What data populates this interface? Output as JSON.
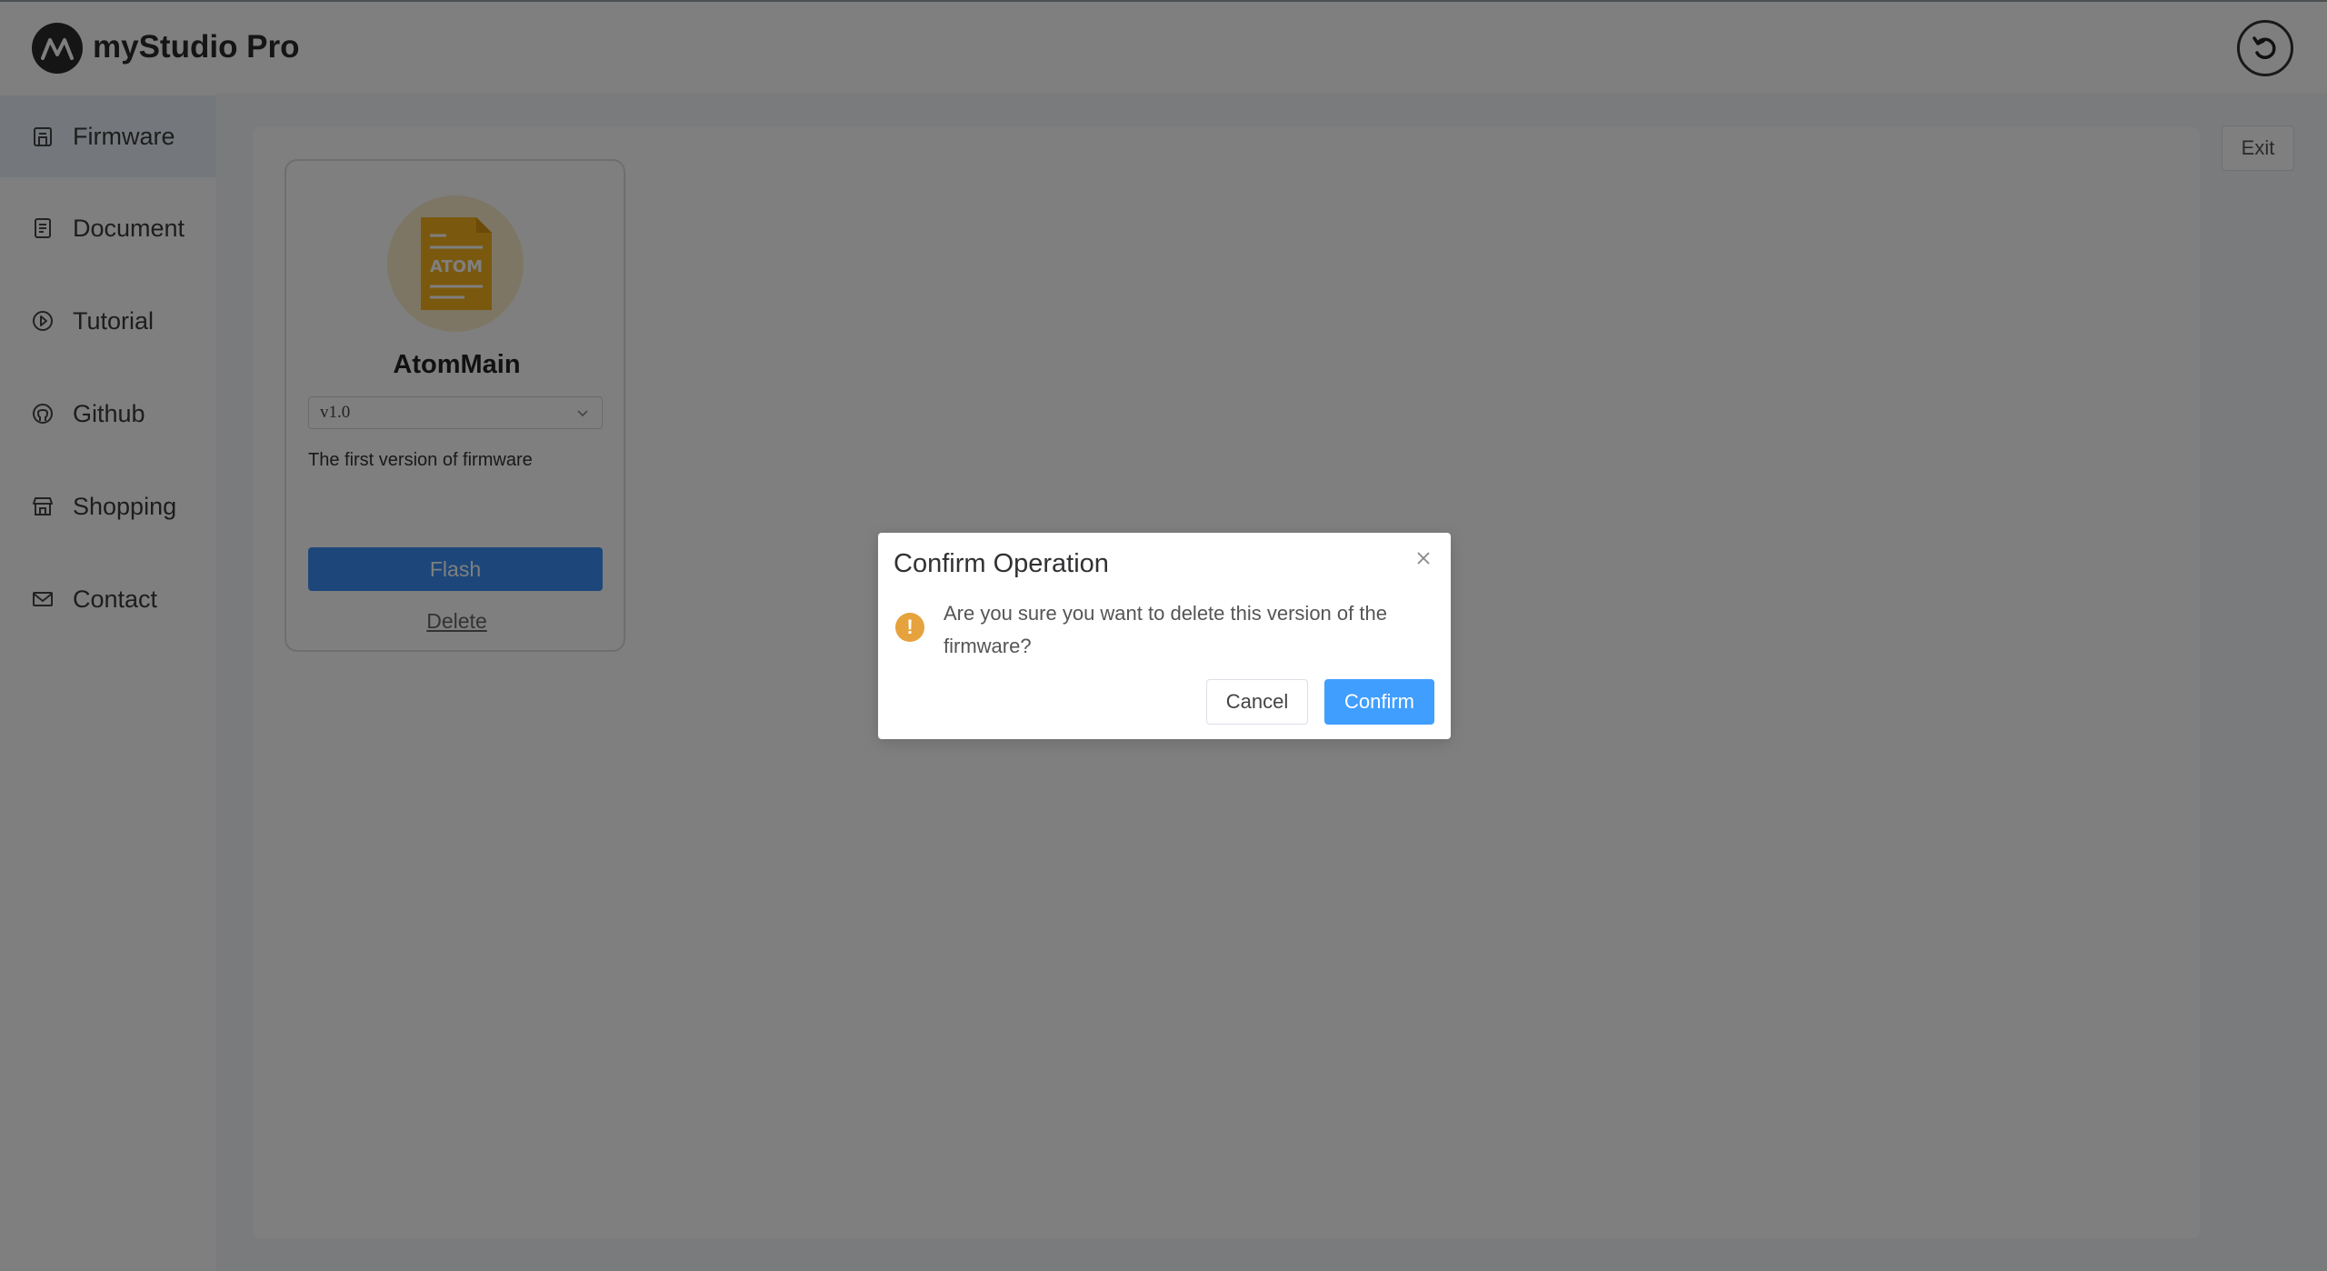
{
  "app": {
    "title": "myStudio Pro",
    "logo_icon": "mystudio-logo-icon",
    "header_button_icon": "refresh-icon"
  },
  "sidebar": {
    "items": [
      {
        "label": "Firmware",
        "icon": "firmware-icon",
        "active": true
      },
      {
        "label": "Document",
        "icon": "document-icon",
        "active": false
      },
      {
        "label": "Tutorial",
        "icon": "play-circle-icon",
        "active": false
      },
      {
        "label": "Github",
        "icon": "github-icon",
        "active": false
      },
      {
        "label": "Shopping",
        "icon": "shop-icon",
        "active": false
      },
      {
        "label": "Contact",
        "icon": "mail-icon",
        "active": false
      }
    ]
  },
  "main": {
    "exit_label": "Exit",
    "card": {
      "icon_text": "ATOM",
      "title": "AtomMain",
      "version": "v1.0",
      "description": "The first version of firmware",
      "flash_label": "Flash",
      "delete_label": "Delete"
    }
  },
  "dialog": {
    "title": "Confirm Operation",
    "message": "Are you sure you want to delete this version of the firmware?",
    "cancel_label": "Cancel",
    "confirm_label": "Confirm"
  },
  "colors": {
    "primary": "#409eff",
    "warning": "#e6a23c",
    "overlay": "rgba(0,0,0,0.5)"
  }
}
